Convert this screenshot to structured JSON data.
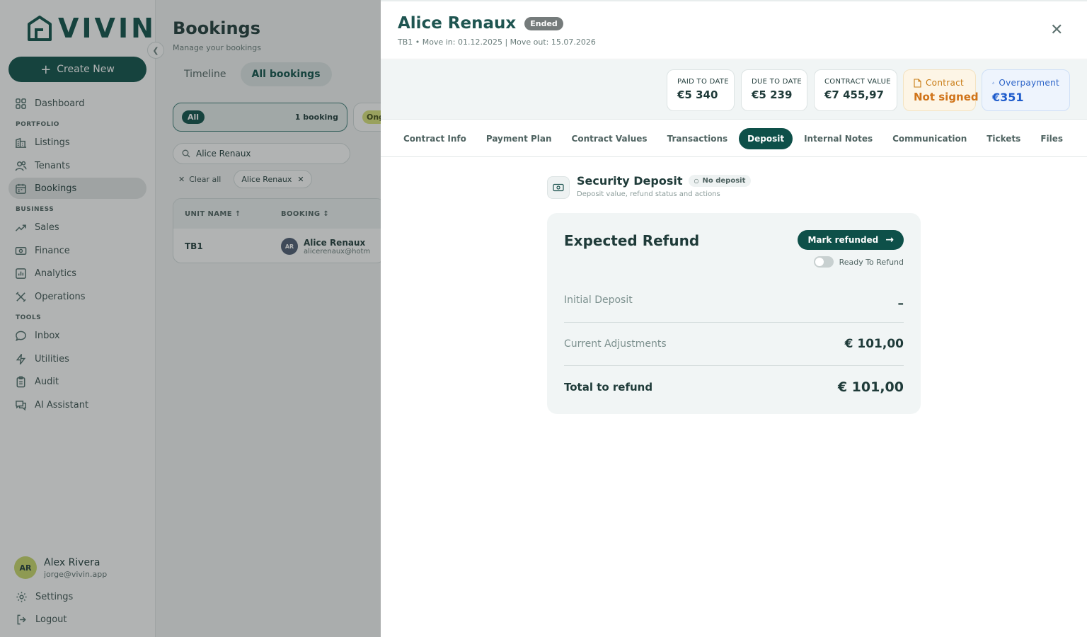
{
  "brand": {
    "name": "VIVIN"
  },
  "sidebar": {
    "create_label": "Create New",
    "dashboard": "Dashboard",
    "section_portfolio": "PORTFOLIO",
    "listings": "Listings",
    "tenants": "Tenants",
    "bookings": "Bookings",
    "section_business": "BUSINESS",
    "sales": "Sales",
    "finance": "Finance",
    "analytics": "Analytics",
    "operations": "Operations",
    "section_tools": "TOOLS",
    "inbox": "Inbox",
    "utilities": "Utilities",
    "audit": "Audit",
    "ai_assistant": "AI Assistant",
    "settings": "Settings",
    "logout": "Logout"
  },
  "user": {
    "initials": "AR",
    "name": "Alex Rivera",
    "email": "jorge@vivin.app"
  },
  "bookings_page": {
    "title": "Bookings",
    "subtitle": "Manage your bookings",
    "tab_timeline": "Timeline",
    "tab_all": "All bookings",
    "filter_all": "All",
    "filter_count": "1 booking",
    "filter_ongoing_partial": "Ong",
    "search_value": "Alice Renaux",
    "clear_all": "Clear all",
    "chip": "Alice Renaux",
    "col_unit": "UNIT NAME ↑",
    "col_booking": "BOOKING ↕",
    "row": {
      "unit": "TB1",
      "initials": "AR",
      "name": "Alice Renaux",
      "email": "alicerenaux@hotm"
    }
  },
  "drawer": {
    "name": "Alice Renaux",
    "status": "Ended",
    "subtitle": "TB1 • Move in: 01.12.2025 | Move out: 15.07.2026",
    "stats": {
      "paid_label": "PAID TO DATE",
      "paid_value": "€5 340",
      "due_label": "DUE TO DATE",
      "due_value": "€5 239",
      "contract_value_label": "CONTRACT VALUE",
      "contract_value": "€7 455,97",
      "contract_label": "Contract",
      "contract_status": "Not signed",
      "overpayment_label": "Overpayment",
      "overpayment_value": "€351"
    },
    "tabs": [
      "Contract Info",
      "Payment Plan",
      "Contract Values",
      "Transactions",
      "Deposit",
      "Internal Notes",
      "Communication",
      "Tickets",
      "Files"
    ],
    "active_tab": "Deposit",
    "deposit": {
      "title": "Security Deposit",
      "badge": "No deposit",
      "subtitle": "Deposit value, refund status and actions",
      "card_title": "Expected Refund",
      "mark_refunded": "Mark refunded",
      "ready_label": "Ready To Refund",
      "ready_to_refund": false,
      "initial_label": "Initial Deposit",
      "initial_value": "–",
      "adjust_label": "Current Adjustments",
      "adjust_value": "€ 101,00",
      "total_label": "Total to refund",
      "total_value": "€ 101,00"
    }
  },
  "colors": {
    "brand": "#0e5049",
    "contract_warning": "#d0741a",
    "overpayment": "#1f5ccc"
  }
}
